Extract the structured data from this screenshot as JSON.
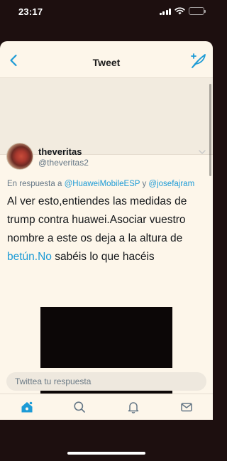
{
  "status_bar": {
    "time": "23:17"
  },
  "nav": {
    "title": "Tweet"
  },
  "tweet": {
    "display_name": "theveritas",
    "handle": "@theveritas2",
    "reply_prefix": "En respuesta a ",
    "mention_1": "@HuaweiMobileESP",
    "reply_conjunction": " y ",
    "mention_2": "@josefajram",
    "text_before_link": "Al ver esto,entiendes las medidas de trump contra huawei.Asociar vuestro nombre a este os deja a la altura de ",
    "link_text": "betún.No",
    "text_after_link": " sabéis lo que hacéis"
  },
  "reply_bar": {
    "placeholder": "Twittea tu respuesta"
  },
  "tabs": [
    {
      "icon": "home-icon",
      "active": true
    },
    {
      "icon": "search-icon",
      "active": false
    },
    {
      "icon": "notifications-icon",
      "active": false
    },
    {
      "icon": "messages-icon",
      "active": false
    }
  ],
  "colors": {
    "accent": "#1d9bd6",
    "background": "#fdf6ea",
    "frame": "#1d0f0f"
  }
}
